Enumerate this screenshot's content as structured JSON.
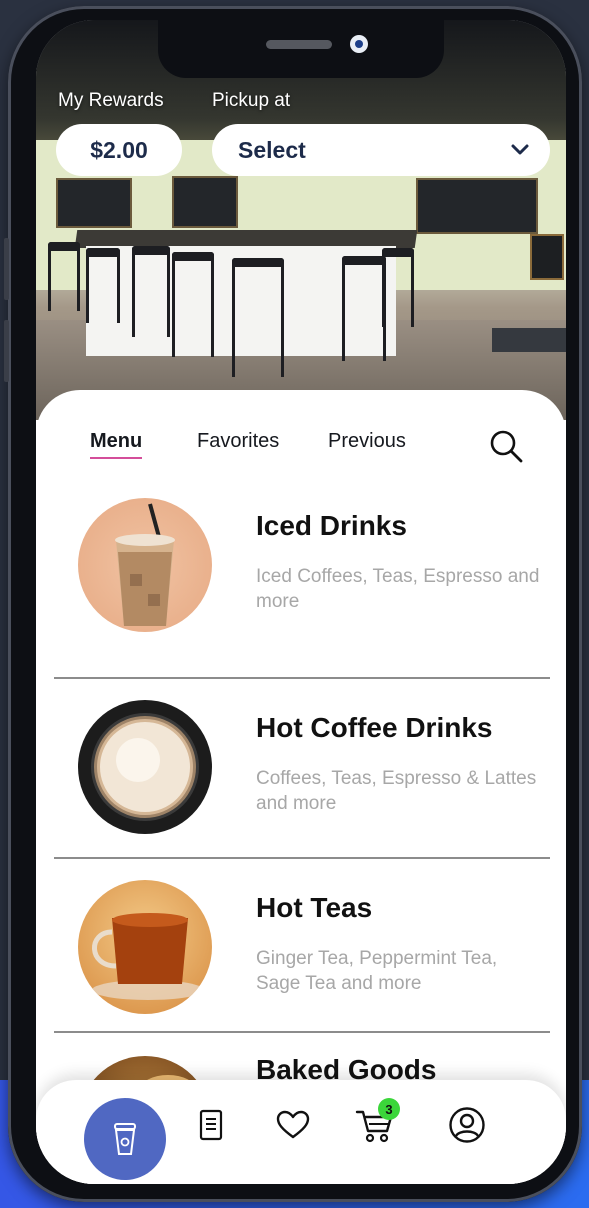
{
  "header": {
    "rewards_label": "My Rewards",
    "pickup_label": "Pickup at",
    "rewards_value": "$2.00",
    "location_select": "Select"
  },
  "tabs": [
    {
      "label": "Menu",
      "active": true
    },
    {
      "label": "Favorites",
      "active": false
    },
    {
      "label": "Previous",
      "active": false
    }
  ],
  "categories": [
    {
      "title": "Iced Drinks",
      "description": "Iced Coffees, Teas, Espresso and more",
      "icon": "iced-coffee-image"
    },
    {
      "title": "Hot Coffee Drinks",
      "description": "Coffees, Teas, Espresso & Lattes and more",
      "icon": "latte-cup-image"
    },
    {
      "title": "Hot Teas",
      "description": "Ginger Tea, Peppermint Tea, Sage Tea and more",
      "icon": "tea-cup-image"
    },
    {
      "title": "Baked Goods",
      "description": "",
      "icon": "pastries-image"
    }
  ],
  "nav": {
    "items": [
      "cup-icon",
      "receipt-icon",
      "heart-icon",
      "cart-icon",
      "profile-icon"
    ],
    "cart_count": "3"
  },
  "colors": {
    "accent": "#5068c2",
    "tab_underline": "#d44e9a",
    "badge": "#3bd63a",
    "text_dark": "#1d2b4a"
  }
}
